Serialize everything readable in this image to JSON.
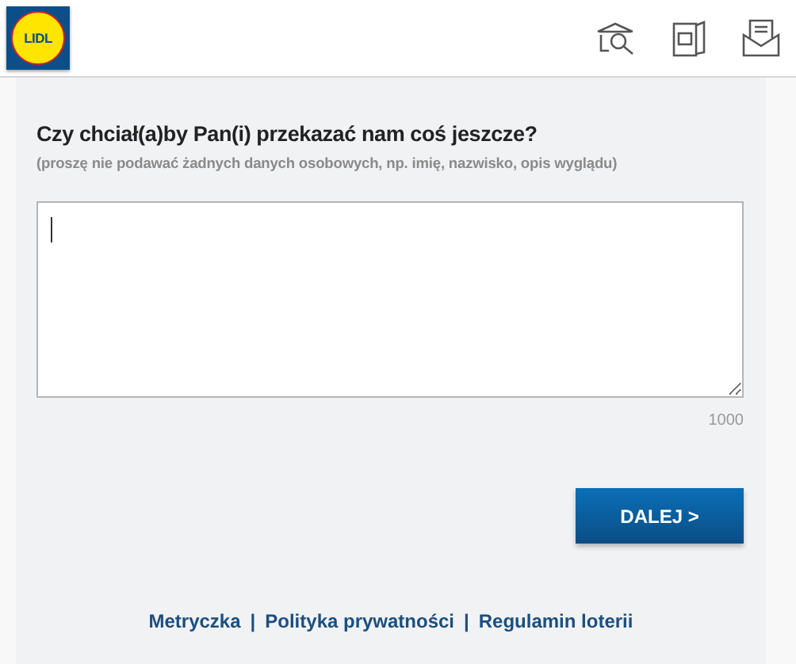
{
  "header": {
    "logo_text": "LIDL"
  },
  "form": {
    "question": "Czy chciał(a)by Pan(i) przekazać nam coś jeszcze?",
    "hint": "(proszę nie podawać żadnych danych osobowych, np. imię, nazwisko, opis wyglądu)",
    "counter": "1000",
    "button": "DALEJ >"
  },
  "footer": {
    "links": [
      "Metryczka",
      "Polityka prywatności",
      "Regulamin loterii"
    ],
    "separator": "|"
  }
}
